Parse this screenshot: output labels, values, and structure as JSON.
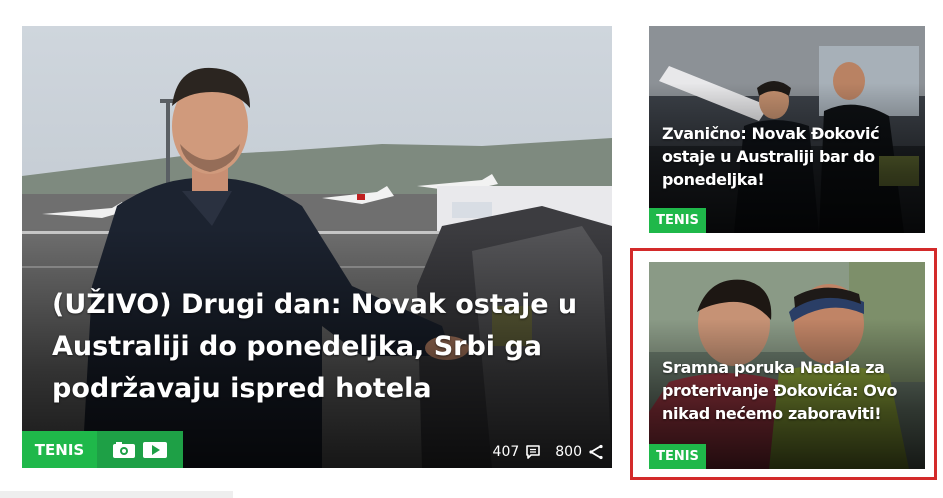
{
  "featured": {
    "headline": "(UŽIVO) Drugi dan: Novak ostaje u Australiji do ponedeljka, Srbi ga podržavaju ispred hotela",
    "category": "TENIS",
    "comments_count": "407",
    "shares_count": "800",
    "media_icons": [
      "camera-icon",
      "play-icon"
    ]
  },
  "side_articles": [
    {
      "headline": "Zvanično: Novak Đoković ostaje u Australiji bar do ponedeljka!",
      "category": "TENIS"
    },
    {
      "headline": "Sramna poruka Nadala za proterivanje Đokovića: Ovo nikad nećemo zaboraviti!",
      "category": "TENIS",
      "highlighted": true
    }
  ],
  "colors": {
    "tag_green": "#1fb84a",
    "media_green": "#1ea046",
    "highlight_red": "#d32a2a"
  }
}
